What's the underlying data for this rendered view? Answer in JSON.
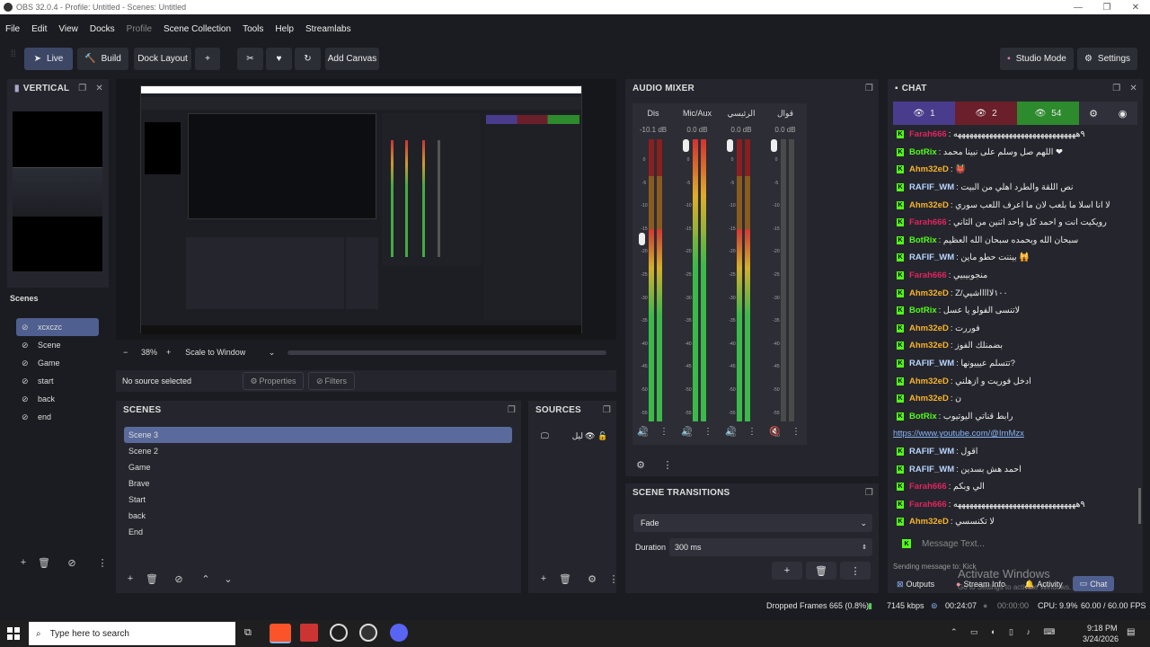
{
  "window": {
    "title": "OBS 32.0.4 - Profile: Untitled - Scenes: Untitled"
  },
  "menu": [
    "File",
    "Edit",
    "View",
    "Docks",
    "Profile",
    "Scene Collection",
    "Tools",
    "Help",
    "Streamlabs"
  ],
  "toolbar": {
    "live": "Live",
    "build": "Build",
    "dock_layout": "Dock Layout",
    "add_canvas": "Add Canvas",
    "studio_mode": "Studio Mode",
    "settings": "Settings"
  },
  "vertical": {
    "title": "VERTICAL",
    "scenes_label": "Scenes",
    "scenes": [
      "xcxczc",
      "Scene",
      "Game",
      "start",
      "back",
      "end"
    ]
  },
  "preview": {
    "zoom": "38%",
    "scale_mode": "Scale to Window",
    "no_source": "No source selected",
    "properties": "Properties",
    "filters": "Filters"
  },
  "scenes": {
    "title": "SCENES",
    "items": [
      "Scene 3",
      "Scene 2",
      "Game",
      "Brave",
      "Start",
      "back",
      "End"
    ],
    "selected": 0
  },
  "sources": {
    "title": "SOURCES",
    "items": [
      {
        "name": "ليل"
      }
    ]
  },
  "audio": {
    "title": "AUDIO MIXER",
    "channels": [
      {
        "name": "Dis",
        "db": "-10.1 dB",
        "level": 0.68,
        "muted": false
      },
      {
        "name": "Mic/Aux",
        "db": "0.0 dB",
        "level": 1.0,
        "muted": false
      },
      {
        "name": "الرئيسي",
        "db": "0.0 dB",
        "level": 0.68,
        "muted": false
      },
      {
        "name": "قوال",
        "db": "0.0 dB",
        "level": 0.0,
        "muted": true
      }
    ],
    "ticks": [
      "0",
      "-5",
      "-10",
      "-15",
      "-20",
      "-25",
      "-30",
      "-35",
      "-40",
      "-45",
      "-50",
      "-55",
      "-60"
    ]
  },
  "transitions": {
    "title": "SCENE TRANSITIONS",
    "transition": "Fade",
    "duration_label": "Duration",
    "duration": "300 ms"
  },
  "chat": {
    "title": "CHAT",
    "counts": [
      "1",
      "2",
      "54"
    ],
    "messages": [
      {
        "user": "Farah666",
        "color": "#e0245e",
        "text": ": ٩هههههههههههههههههههههههههههههههه"
      },
      {
        "user": "BotRix",
        "color": "#53fc18",
        "text": ": اللهم صل وسلم على نبينا محمد ❤"
      },
      {
        "user": "Ahm32eD",
        "color": "#f7b32b",
        "text": ": 👹"
      },
      {
        "user": "RAFIF_WM",
        "color": "#b7d4ff",
        "text": ": نص اللقة والطرد اهلي من البيت"
      },
      {
        "user": "Ahm32eD",
        "color": "#f7b32b",
        "text": ": لا انا اسلا ما بلعب لان ما اعرف اللعب سوري"
      },
      {
        "user": "Farah666",
        "color": "#e0245e",
        "text": ": رويكيت انت و احمد كل واحد اثنين من الثاني"
      },
      {
        "user": "BotRix",
        "color": "#53fc18",
        "text": ": سبحان الله وبحمده سبحان الله العظيم"
      },
      {
        "user": "RAFIF_WM",
        "color": "#b7d4ff",
        "text": ": بيننت حطو ماين 🙀"
      },
      {
        "user": "Farah666",
        "color": "#e0245e",
        "text": ": منجوبيبيي"
      },
      {
        "user": "Ahm32eD",
        "color": "#f7b32b",
        "text": ": Z/١٠٠لاااااشيي"
      },
      {
        "user": "BotRix",
        "color": "#53fc18",
        "text": ": لاتنسى الفولو يا عسل"
      },
      {
        "user": "Ahm32eD",
        "color": "#f7b32b",
        "text": ": فوررت"
      },
      {
        "user": "Ahm32eD",
        "color": "#f7b32b",
        "text": ": بضمنلك الفوز"
      },
      {
        "user": "RAFIF_WM",
        "color": "#b7d4ff",
        "text": ": تتسلم عيييونها?"
      },
      {
        "user": "Ahm32eD",
        "color": "#f7b32b",
        "text": ": ادخل فوريت و ازهلني"
      },
      {
        "user": "Ahm32eD",
        "color": "#f7b32b",
        "text": ": ن"
      },
      {
        "user": "BotRix",
        "color": "#53fc18",
        "text": ": رابط قناتي اليوتيوب"
      },
      {
        "user": "",
        "color": "#8ab4f8",
        "text": "https://www.youtube.com/@ImMzx"
      },
      {
        "user": "RAFIF_WM",
        "color": "#b7d4ff",
        "text": ": اقول"
      },
      {
        "user": "RAFIF_WM",
        "color": "#b7d4ff",
        "text": ": احمد هش بسدين"
      },
      {
        "user": "Farah666",
        "color": "#e0245e",
        "text": ": الي وبكم"
      },
      {
        "user": "Farah666",
        "color": "#e0245e",
        "text": ": ٩هههههههههههههههههههههههههههههههه"
      },
      {
        "user": "Ahm32eD",
        "color": "#f7b32b",
        "text": ": لا تكنسسي"
      }
    ],
    "input_placeholder": "Message Text...",
    "sending_to": "Sending message to: Kick",
    "footer": {
      "outputs": "Outputs",
      "stream_info": "Stream Info",
      "activity": "Activity",
      "chat": "Chat"
    },
    "watermark": "Activate Windows",
    "watermark_sub": "Go to Settings to activate Windows."
  },
  "status": {
    "dropped": "Dropped Frames 665 (0.8%)",
    "kbps": "7145 kbps",
    "live_time": "00:24:07",
    "rec_time": "00:00:00",
    "cpu": "CPU: 9.9%",
    "fps": "60.00 / 60.00 FPS"
  },
  "taskbar": {
    "search_placeholder": "Type here to search",
    "time": "9:18 PM",
    "date": "3/24/2026"
  }
}
